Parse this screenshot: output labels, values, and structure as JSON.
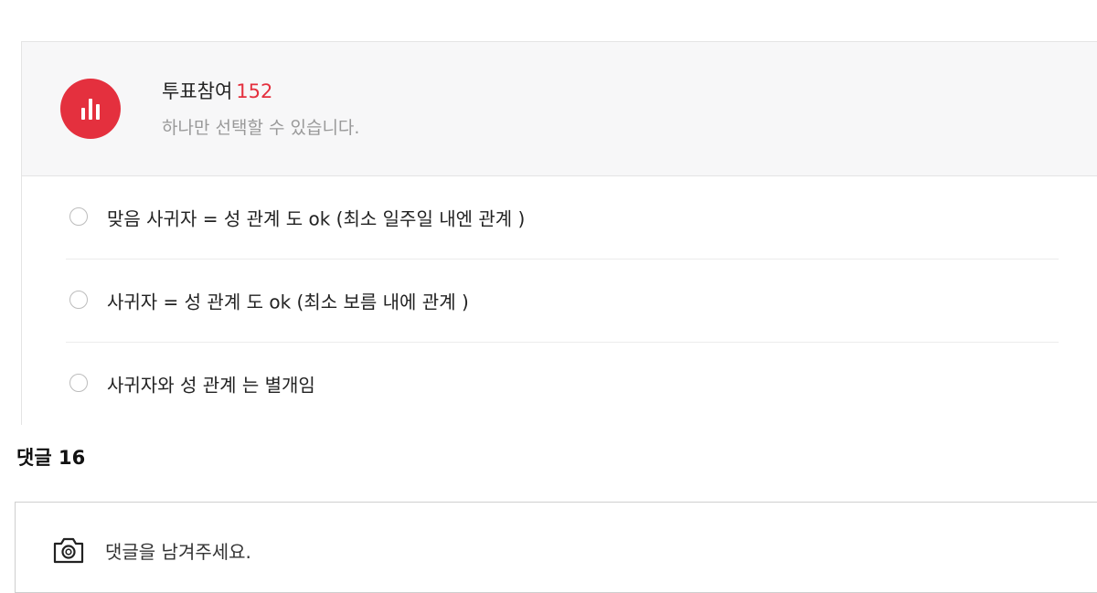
{
  "poll": {
    "title": "투표참여",
    "count": "152",
    "subtitle": "하나만 선택할 수 있습니다.",
    "icon": "bar-chart-icon",
    "accent_color": "#e4303e",
    "options": [
      {
        "label": "맞음 사귀자 = 성 관계 도 ok (최소 일주일 내엔 관계 )"
      },
      {
        "label": "사귀자 = 성 관계 도 ok (최소 보름 내에 관계 )"
      },
      {
        "label": "사귀자와 성 관계 는 별개임"
      }
    ]
  },
  "comments": {
    "header": "댓글 16",
    "input_placeholder": "댓글을 남겨주세요.",
    "camera_icon": "camera-icon"
  }
}
